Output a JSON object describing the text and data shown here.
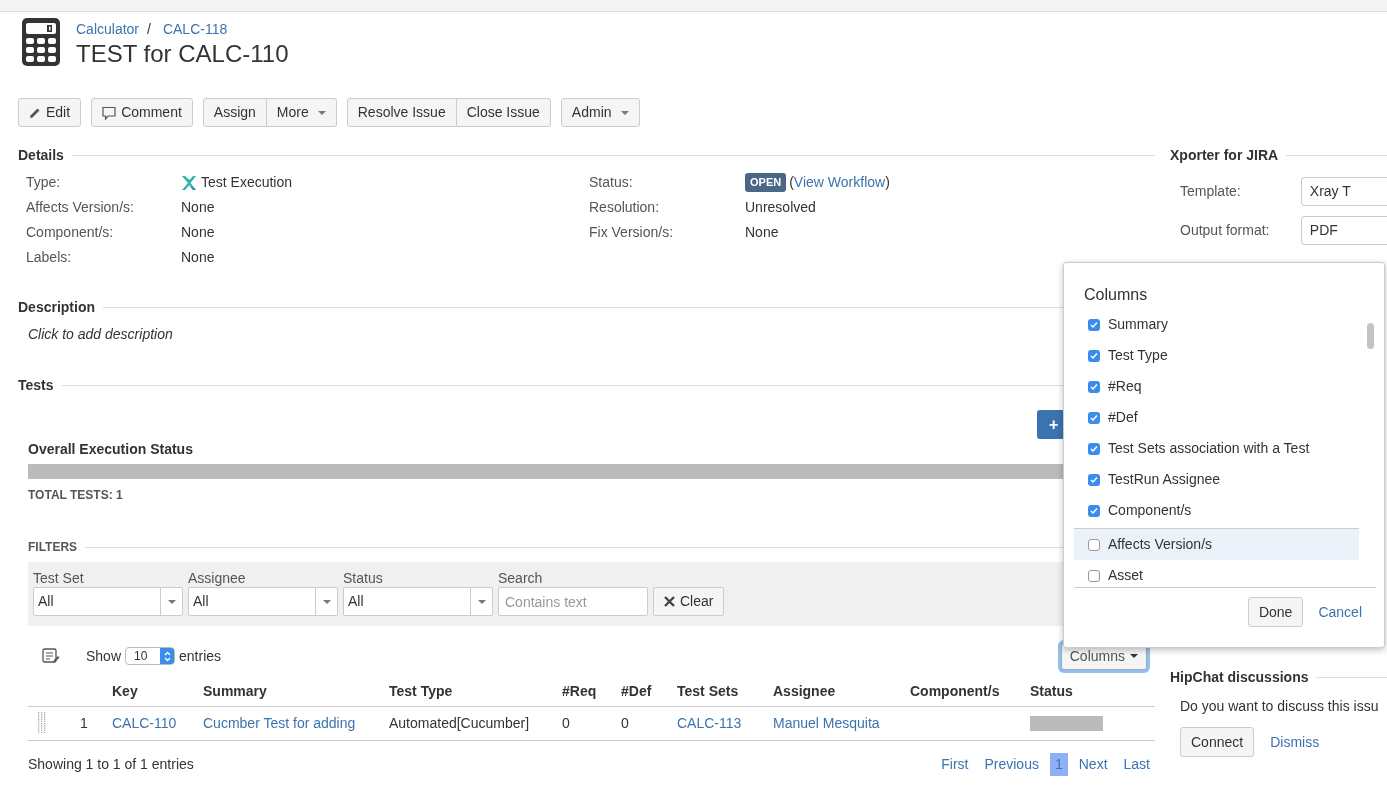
{
  "breadcrumbs": [
    {
      "label": "Calculator"
    },
    {
      "label": "CALC-118"
    }
  ],
  "breadcrumb_separator": "/",
  "title": "TEST for CALC-110",
  "toolbar": [
    [
      {
        "label": "Edit",
        "dropdown": false
      }
    ],
    [
      {
        "label": "Comment",
        "dropdown": false
      }
    ],
    [
      {
        "label": "Assign",
        "dropdown": false
      },
      {
        "label": "More",
        "dropdown": true
      }
    ],
    [
      {
        "label": "Resolve Issue",
        "dropdown": false
      },
      {
        "label": "Close Issue",
        "dropdown": false
      }
    ],
    [
      {
        "label": "Admin",
        "dropdown": true
      }
    ]
  ],
  "details": {
    "heading": "Details",
    "left": [
      {
        "label": "Type:",
        "value": "Test Execution",
        "kind": "typed"
      },
      {
        "label": "Affects Version/s:",
        "value": "None",
        "kind": "text"
      },
      {
        "label": "Component/s:",
        "value": "None",
        "kind": "text"
      },
      {
        "label": "Labels:",
        "value": "None",
        "kind": "text"
      }
    ],
    "right": [
      {
        "label": "Status:",
        "kind": "status",
        "badge": "OPEN",
        "before": "(",
        "link": "View Workflow",
        "after": ")"
      },
      {
        "label": "Resolution:",
        "kind": "text",
        "value": "Unresolved"
      },
      {
        "label": "Fix Version/s:",
        "kind": "text",
        "value": "None"
      }
    ]
  },
  "description": {
    "heading": "Description",
    "placeholder": "Click to add description"
  },
  "tests": {
    "heading": "Tests",
    "add_button": "+",
    "overall_heading": "Overall Execution Status",
    "progress": {
      "level": 1
    },
    "total": "TOTAL TESTS: 1"
  },
  "filters": {
    "heading": "FILTERS",
    "selects": [
      {
        "label": "Test Set",
        "value": "All"
      },
      {
        "label": "Assignee",
        "value": "All"
      },
      {
        "label": "Status",
        "value": "All"
      }
    ],
    "search": {
      "label": "Search",
      "placeholder": "Contains text"
    },
    "clear_button": "Clear"
  },
  "table": {
    "show_label": "Show",
    "page_size": "10",
    "entries_label": "entries",
    "columns_button": "Columns",
    "columns": [
      "Key",
      "Summary",
      "Test Type",
      "#Req",
      "#Def",
      "Test Sets",
      "Assignee",
      "Component/s",
      "Status"
    ],
    "rows": [
      {
        "rank": "1",
        "cells": [
          {
            "kind": "link",
            "text": "CALC-110"
          },
          {
            "kind": "link",
            "text": "Cucmber Test for adding"
          },
          {
            "kind": "text",
            "text": "Automated[Cucumber]"
          },
          {
            "kind": "text",
            "text": "0"
          },
          {
            "kind": "text",
            "text": "0"
          },
          {
            "kind": "link",
            "text": "CALC-113"
          },
          {
            "kind": "link",
            "text": "Manuel Mesquita"
          },
          {
            "kind": "empty"
          },
          {
            "kind": "bar"
          }
        ]
      }
    ],
    "info": "Showing 1 to 1 of 1 entries",
    "pagination": [
      {
        "label": "First",
        "selected": false
      },
      {
        "label": "Previous",
        "selected": false
      },
      {
        "label": "1",
        "selected": true
      },
      {
        "label": "Next",
        "selected": false
      },
      {
        "label": "Last",
        "selected": false
      }
    ]
  },
  "xporter": {
    "heading": "Xporter for JIRA",
    "fields": [
      {
        "label": "Template:",
        "value": "Xray T"
      },
      {
        "label": "Output format:",
        "value": "PDF"
      }
    ]
  },
  "hipchat": {
    "heading": "HipChat discussions",
    "text": "Do you want to discuss this issu",
    "connect": "Connect",
    "dismiss": "Dismiss"
  },
  "columns_popup": {
    "title": "Columns",
    "options": [
      {
        "label": "Summary",
        "checked": true,
        "highlighted": false
      },
      {
        "label": "Test Type",
        "checked": true,
        "highlighted": false
      },
      {
        "label": "#Req",
        "checked": true,
        "highlighted": false
      },
      {
        "label": "#Def",
        "checked": true,
        "highlighted": false
      },
      {
        "label": "Test Sets association with a Test",
        "checked": true,
        "highlighted": false
      },
      {
        "label": "TestRun Assignee",
        "checked": true,
        "highlighted": false
      },
      {
        "label": "Component/s",
        "checked": true,
        "highlighted": false
      },
      {
        "label": "Affects Version/s",
        "checked": false,
        "highlighted": true
      },
      {
        "label": "Asset",
        "checked": false,
        "highlighted": false
      }
    ],
    "done": "Done",
    "cancel": "Cancel"
  }
}
